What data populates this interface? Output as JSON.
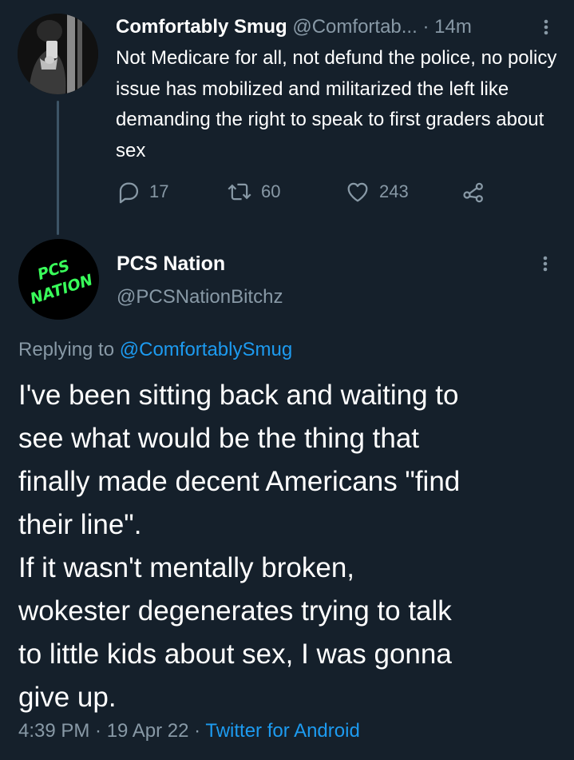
{
  "parent_tweet": {
    "display_name": "Comfortably Smug",
    "handle": "@Comfortab...",
    "separator": "·",
    "time": "14m",
    "text": "Not Medicare for all, not defund the police, no policy issue has mobilized and militarized the left like demanding the right to speak to first graders about sex",
    "actions": {
      "replies": "17",
      "retweets": "60",
      "likes": "243"
    }
  },
  "main_tweet": {
    "display_name": "PCS Nation",
    "handle": "@PCSNationBitchz",
    "avatar_text": [
      "PCS",
      "NATION"
    ],
    "replying_prefix": "Replying to",
    "replying_to": "@ComfortablySmug",
    "text_lines": [
      "I've been sitting back and waiting to",
      "see what would be the thing that",
      "finally made decent Americans \"find",
      "their line\".",
      "If it wasn't mentally broken,",
      "wokester degenerates trying to talk",
      "to little kids about sex, I was gonna",
      "give up."
    ],
    "timestamp": "4:39 PM · 19 Apr 22",
    "meta_separator": "·",
    "source": "Twitter for Android"
  },
  "colors": {
    "background": "#15202b",
    "text_primary": "#ffffff",
    "text_secondary": "#8899a6",
    "link": "#1d9bf0",
    "avatar_neon": "#39ff5a"
  },
  "icons": {
    "reply": "reply-icon",
    "retweet": "retweet-icon",
    "like": "heart-icon",
    "share": "share-icon",
    "more": "more-vertical-icon"
  }
}
